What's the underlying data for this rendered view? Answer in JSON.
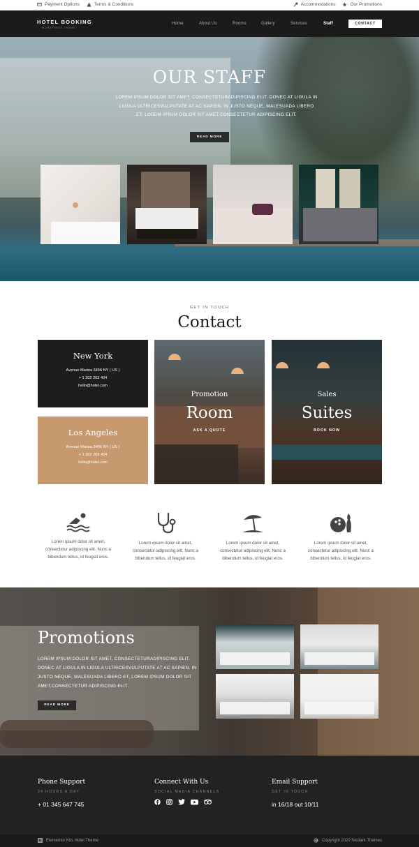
{
  "topbar": {
    "left": [
      {
        "icon": "credit-card-icon",
        "label": "Payment Options"
      },
      {
        "icon": "warning-icon",
        "label": "Terms & Conditions"
      }
    ],
    "right": [
      {
        "icon": "key-icon",
        "label": "Accommodations"
      },
      {
        "icon": "star-icon",
        "label": "Our Promotions"
      }
    ]
  },
  "nav": {
    "logo": "HOTEL BOOKING",
    "logo_sub": "WORDPRESS THEME",
    "items": [
      "Home",
      "About Us",
      "Rooms",
      "Gallery",
      "Services",
      "Staff"
    ],
    "active": "Staff",
    "cta": "CONTACT"
  },
  "hero": {
    "title": "OUR STAFF",
    "text": "LOREM IPSUM DOLOR SIT AMET, CONSECTETURADIPISCING ELIT. DONEC AT LIGULA IN LIGULA ULTRICESVULPUTATE AT AC SAPIEN. IN JUSTO NEQUE, MALESUADA LIBERO ET, LOREM IPSUM DOLOR SIT AMET,CONSECTETUR ADIPISCING ELIT.",
    "button": "READ MORE"
  },
  "contact": {
    "eyebrow": "GET IN TOUCH",
    "title": "Contact",
    "cities": [
      {
        "name": "New York",
        "address": "Avenue Marina 3456 NY ( US )",
        "phone": "+ 1 202 203 404",
        "email": "hello@hotel.com"
      },
      {
        "name": "Los Angeles",
        "address": "Avenue Marina 3456 NY ( US )",
        "phone": "+ 1 202 203 404",
        "email": "hello@hotel.com"
      }
    ],
    "promos": [
      {
        "small": "Promotion",
        "big": "Room",
        "cta": "ASK A QUOTE"
      },
      {
        "small": "Sales",
        "big": "Suites",
        "cta": "BOOK NOW"
      }
    ]
  },
  "features": [
    {
      "icon": "swimming-icon",
      "text": "Lorem ipsum dolor sit amet, consectetur adipiscing elit. Nunc a bibendum tellus, id feugiat eros."
    },
    {
      "icon": "stethoscope-icon",
      "text": "Lorem ipsum dolor sit amet, consectetur adipiscing elit. Nunc a bibendum tellus, id feugiat eros."
    },
    {
      "icon": "beach-umbrella-icon",
      "text": "Lorem ipsum dolor sit amet, consectetur adipiscing elit. Nunc a bibendum tellus, id feugiat eros."
    },
    {
      "icon": "bowling-icon",
      "text": "Lorem ipsum dolor sit amet, consectetur adipiscing elit. Nunc a bibendum tellus, id feugiat eros."
    }
  ],
  "promotions": {
    "title": "Promotions",
    "text": "LOREM IPSUM DOLOR SIT AMET, CONSECTETURADIPISCING ELIT. DONEC AT LIGULA IN LIGULA ULTRICESVULPUTATE AT AC SAPIEN. IN JUSTO NEQUE, MALESUADA LIBERO ET, LOREM IPSUM DOLOR SIT AMET,CONSECTETUR ADIPISCING ELIT.",
    "button": "READ MORE"
  },
  "footer": {
    "cols": [
      {
        "title": "Phone Support",
        "sub": "24 HOURS A DAY",
        "value": "+ 01 345 647 745"
      },
      {
        "title": "Connect With Us",
        "sub": "SOCIAL MEDIA CHANNELS",
        "social": [
          "facebook-icon",
          "instagram-icon",
          "twitter-icon",
          "youtube-icon",
          "tripadvisor-icon"
        ]
      },
      {
        "title": "Email Support",
        "sub": "GET IN TOUCH",
        "value": "in 16/18 out 10/11"
      }
    ],
    "bottom_left": "Elementor Kits Hotel Theme",
    "bottom_right": "Copyright 2020 Nicdark Themes"
  },
  "colors": {
    "dark": "#1d1d1d",
    "accent": "#c69a6e",
    "nav_bg": "#1b1b1b",
    "footer_bg": "#222222"
  }
}
